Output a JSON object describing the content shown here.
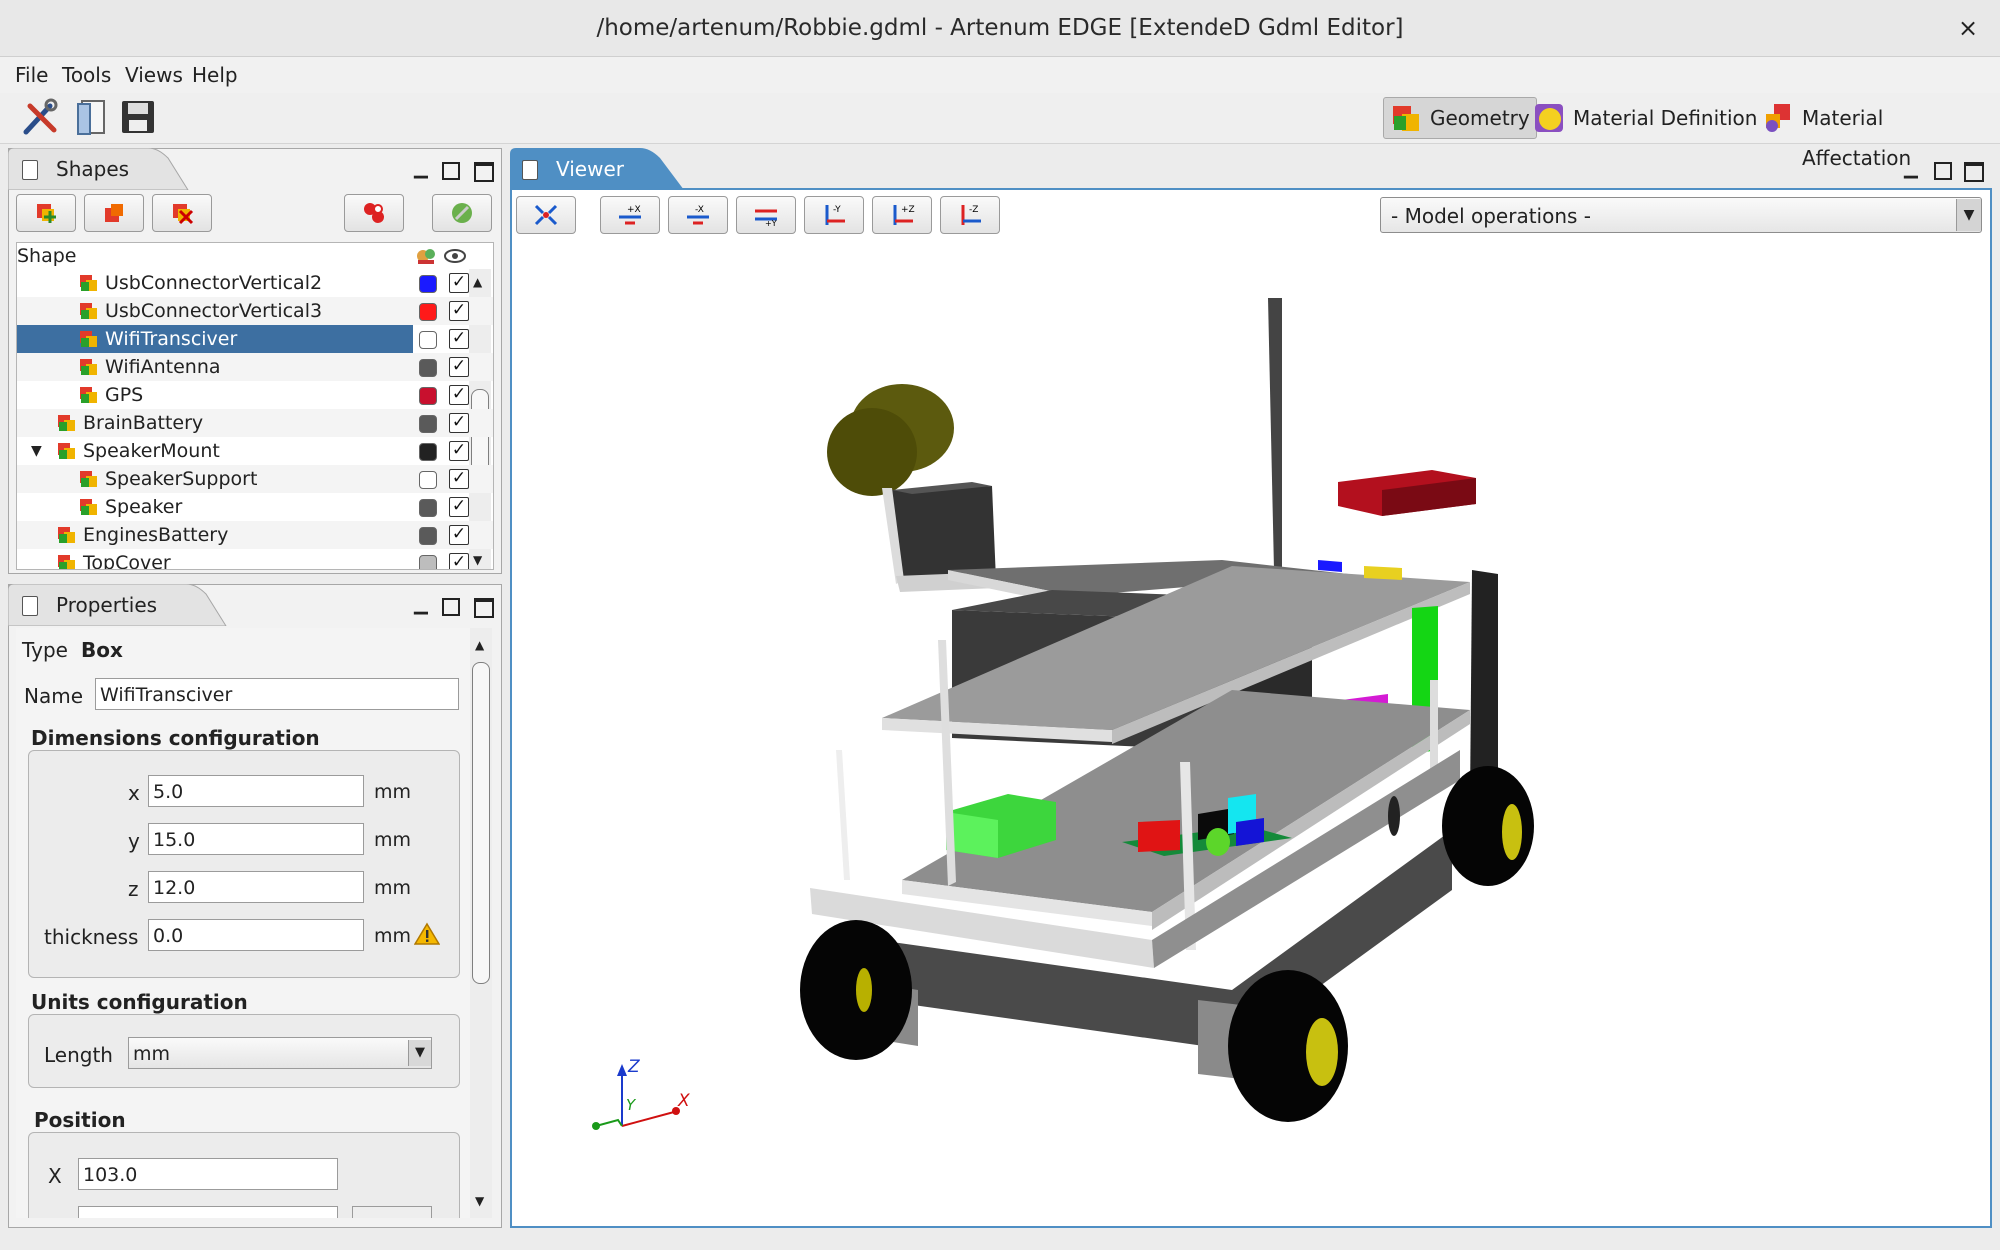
{
  "window": {
    "title": "/home/artenum/Robbie.gdml - Artenum EDGE [ExtendeD Gdml Editor]",
    "close": "×"
  },
  "menu": [
    "File",
    "Tools",
    "Views",
    "Help"
  ],
  "toolbar": {
    "icons": [
      "tools-icon",
      "open-document-icon",
      "save-icon"
    ],
    "modes": [
      {
        "label": "Geometry",
        "active": true,
        "icon": "geometry-icon"
      },
      {
        "label": "Material Definition",
        "active": false,
        "icon": "material-definition-icon"
      },
      {
        "label": "Material Affectation",
        "active": false,
        "icon": "material-affectation-icon"
      }
    ]
  },
  "shapes_panel": {
    "tab": "Shapes",
    "column_header": "Shape",
    "rows": [
      {
        "name": "UsbConnectorVertical2",
        "color": "#1a1aff",
        "visible": true,
        "selected": false
      },
      {
        "name": "UsbConnectorVertical3",
        "color": "#ff1a1a",
        "visible": true,
        "selected": false
      },
      {
        "name": "WifiTransciver",
        "color": "#ffffff",
        "visible": true,
        "selected": true
      },
      {
        "name": "WifiAntenna",
        "color": "#5a5a5a",
        "visible": true,
        "selected": false
      },
      {
        "name": "GPS",
        "color": "#c8102e",
        "visible": true,
        "selected": false
      },
      {
        "name": "BrainBattery",
        "color": "#5a5a5a",
        "visible": true,
        "selected": false
      },
      {
        "name": "SpeakerMount",
        "color": "#222222",
        "visible": true,
        "selected": false,
        "expanded": true
      },
      {
        "name": "SpeakerSupport",
        "color": "#ffffff",
        "visible": true,
        "selected": false
      },
      {
        "name": "Speaker",
        "color": "#5a5a5a",
        "visible": true,
        "selected": false
      },
      {
        "name": "EnginesBattery",
        "color": "#5a5a5a",
        "visible": true,
        "selected": false
      },
      {
        "name": "TopCover",
        "color": "#bdbdbd",
        "visible": true,
        "selected": false
      }
    ]
  },
  "properties_panel": {
    "tab": "Properties",
    "type_label": "Type",
    "type_value": "Box",
    "name_label": "Name",
    "name_value": "WifiTransciver",
    "dimensions": {
      "title": "Dimensions configuration",
      "x_label": "x",
      "x_value": "5.0",
      "y_label": "y",
      "y_value": "15.0",
      "z_label": "z",
      "z_value": "12.0",
      "thickness_label": "thickness",
      "thickness_value": "0.0",
      "unit": "mm"
    },
    "units": {
      "title": "Units configuration",
      "length_label": "Length",
      "length_value": "mm"
    },
    "position": {
      "title": "Position",
      "x_label": "X",
      "x_value": "103.0"
    }
  },
  "viewer": {
    "tab": "Viewer",
    "buttons": [
      "fit-view-icon",
      "view-plus-x-icon",
      "view-minus-x-icon",
      "view-plus-y-icon",
      "view-minus-y-icon",
      "view-plus-z-icon",
      "view-minus-z-icon"
    ],
    "button_labels": [
      "+X",
      "-X",
      "+Y",
      "-Y",
      "+Z",
      "-Z"
    ],
    "model_operations": "- Model operations -",
    "axes": {
      "x": "X",
      "y": "Y",
      "z": "Z"
    }
  }
}
